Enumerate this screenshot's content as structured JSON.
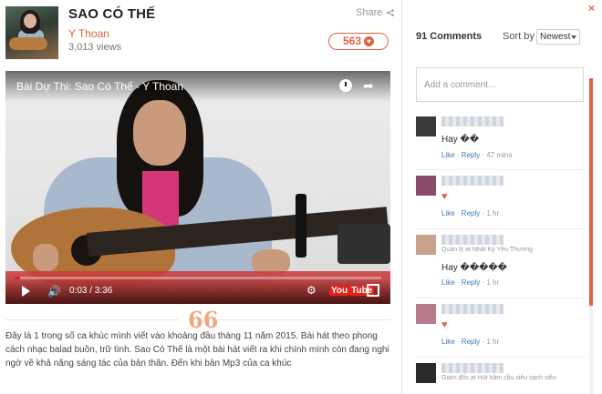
{
  "song": {
    "title": "SAO CÓ THẾ",
    "artist": "Y Thoan",
    "views": "3,013 views",
    "share_label": "Share",
    "like_count": "563"
  },
  "video": {
    "title": "Bài Dự Thi: Sao Có Thế - Y Thoan",
    "time": "0:03 / 3:36",
    "progress": 0.014,
    "brand": "You",
    "brand_tube": "Tube"
  },
  "description": {
    "quote_mark": "66",
    "text": "Đây là 1 trong số ca khúc mình viết vào khoảng đầu tháng 11 năm 2015. Bài hát theo phong cách nhạc balad buồn, trữ tình. Sao Có Thế là một bài hát viết ra khi chính mình còn đang nghi ngờ về khả năng sáng tác của bản thân. Đến khi bản Mp3 của ca khúc"
  },
  "comments": {
    "close_label": "×",
    "count": "91 Comments",
    "sort_label": "Sort by",
    "sort_value": "Newest",
    "add_placeholder": "Add a comment...",
    "like_label": "Like",
    "reply_label": "Reply",
    "items": [
      {
        "subtitle": "",
        "text": "Hay ��",
        "heart": false,
        "time": "47 mins"
      },
      {
        "subtitle": "",
        "text": "",
        "heart": true,
        "time": "1 hr"
      },
      {
        "subtitle": "Quản lý at Nhật Ký Yêu Thương",
        "text": "Hay �����",
        "heart": false,
        "time": "1 hr"
      },
      {
        "subtitle": "",
        "text": "",
        "heart": true,
        "time": "1 hr"
      },
      {
        "subtitle": "Giám đốc at Hút hầm cầu siêu sạch siêu",
        "text": "",
        "heart": false,
        "time": ""
      }
    ]
  },
  "colors": {
    "accent": "#e0633f",
    "link": "#3b7bbf"
  }
}
